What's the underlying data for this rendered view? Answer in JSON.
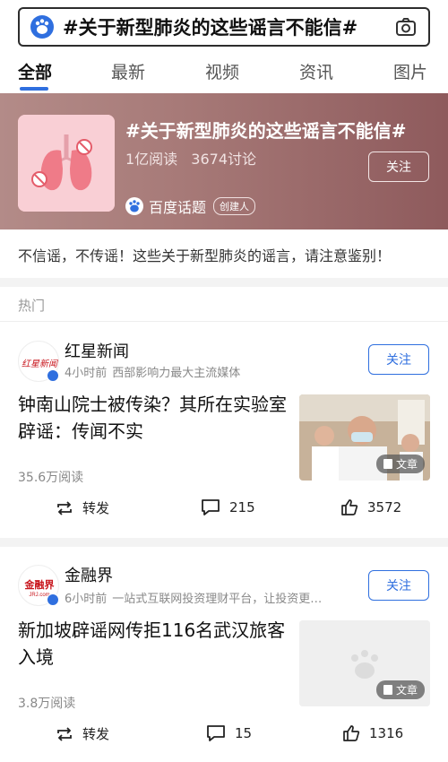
{
  "search": {
    "query": "#关于新型肺炎的这些谣言不能信#"
  },
  "tabs": [
    "全部",
    "最新",
    "视频",
    "资讯",
    "图片"
  ],
  "hero": {
    "title": "#关于新型肺炎的这些谣言不能信#",
    "reads": "1亿阅读",
    "discussions": "3674讨论",
    "follow_label": "关注",
    "source_name": "百度话题",
    "creator_badge": "创建人"
  },
  "description": "不信谣，不传谣！这些关于新型肺炎的谣言，请注意鉴别！",
  "section_label": "热门",
  "cards": [
    {
      "author": "红星新闻",
      "avatar_text": "红星新闻",
      "time": "4小时前",
      "desc": "西部影响力最大主流媒体",
      "follow_label": "关注",
      "headline": "钟南山院士被传染？其所在实验室辟谣：传闻不实",
      "reads": "35.6万阅读",
      "tag": "文章",
      "share_label": "转发",
      "comments": "215",
      "likes": "3572"
    },
    {
      "author": "金融界",
      "avatar_text": "金融界",
      "avatar_sub": "JRJ.com",
      "time": "6小时前",
      "desc": "一站式互联网投资理财平台，让投资更简单",
      "follow_label": "关注",
      "headline": "新加坡辟谣网传拒116名武汉旅客入境",
      "reads": "3.8万阅读",
      "tag": "文章",
      "share_label": "转发",
      "comments": "15",
      "likes": "1316"
    }
  ],
  "colors": {
    "accent": "#2f6fdf",
    "hero_bg": "#a77a78"
  }
}
